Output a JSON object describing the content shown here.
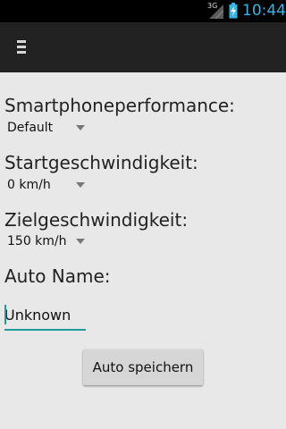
{
  "status_bar": {
    "network_type": "3G",
    "time": "10:44",
    "icons": [
      "signal-icon",
      "battery-charging-icon"
    ],
    "accent_color": "#33b5e5"
  },
  "action_bar": {
    "icon": "menu-icon"
  },
  "form": {
    "performance_label": "Smartphoneperformance:",
    "performance_value": "Default",
    "start_speed_label": "Startgeschwindigkeit:",
    "start_speed_value": "0 km/h",
    "target_speed_label": "Zielgeschwindigkeit:",
    "target_speed_value": "150 km/h",
    "car_name_label": "Auto Name:",
    "car_name_value": "Unknown",
    "save_button": "Auto speichern",
    "input_underline_color": "#1e9b9b"
  }
}
